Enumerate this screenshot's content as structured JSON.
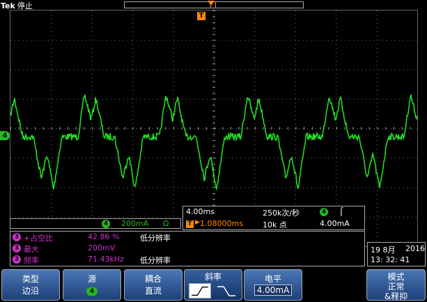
{
  "header": {
    "brand": "Tek",
    "run_state": "停止"
  },
  "channel": {
    "number": "4",
    "color": "#22bb22",
    "scale": "200mA",
    "bw_limit_icon": "Ω"
  },
  "timebase": {
    "horizontal_scale": "4.00ms",
    "sample_rate": "250k次/秒",
    "trigger_position": "1.08000ms",
    "record_length": "10k 点",
    "trigger_channel": "4",
    "trigger_edge_icon": "rising-edge-icon",
    "trigger_level": "4.00mA"
  },
  "measurements": [
    {
      "channel": "3",
      "name": "+占空比",
      "value": "42.86 %",
      "note": "低分辨率"
    },
    {
      "channel": "3",
      "name": "最大",
      "value": "200mV",
      "note": ""
    },
    {
      "channel": "3",
      "name": "频率",
      "value": "71.43kHz",
      "note": "低分辨率"
    }
  ],
  "datetime": {
    "date": "19 8月",
    "year": "2016",
    "time": "13: 32: 41"
  },
  "menu": {
    "type_label": "类型",
    "type_value": "边沿",
    "source_label": "源",
    "source_value": "4",
    "coupling_label": "耦合",
    "coupling_value": "直流",
    "slope_label": "斜率",
    "level_label": "电平",
    "level_value": "4.00mA",
    "mode_label": "模式",
    "mode_value": "正常",
    "mode_value2": "&释抑"
  },
  "colors": {
    "trace": "#22dd22",
    "trigger": "#ff8800",
    "measurement": "#cc33cc",
    "menu": "#2f5a9a"
  }
}
